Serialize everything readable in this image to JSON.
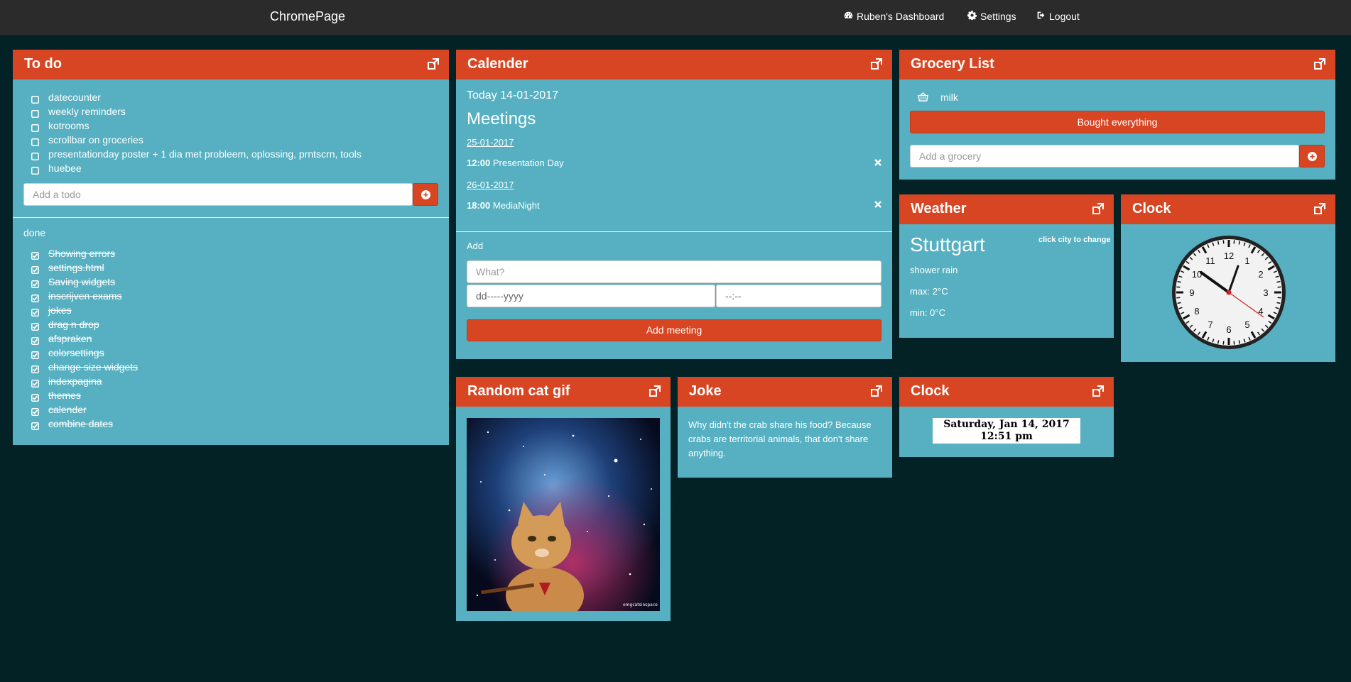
{
  "topbar": {
    "brand": "ChromePage",
    "dashboard": "Ruben's Dashboard",
    "settings": "Settings",
    "logout": "Logout"
  },
  "todo": {
    "title": "To do",
    "items": [
      "datecounter",
      "weekly reminders",
      "kotrooms",
      "scrollbar on groceries",
      "presentationday poster + 1 dia met probleem, oplossing, prntscrn, tools",
      "huebee"
    ],
    "add_placeholder": "Add a todo",
    "done_label": "done",
    "done_items": [
      "Showing errors",
      "settings.html",
      "Saving widgets",
      "inscrijven exams",
      "jokes",
      "drag n drop",
      "afspraken",
      "colorsettings",
      "change size widgets",
      "indexpagina",
      "themes",
      "calender",
      "combine dates"
    ]
  },
  "calendar": {
    "title": "Calender",
    "today": "Today 14-01-2017",
    "meetings_heading": "Meetings",
    "meetings": [
      {
        "date": "25-01-2017",
        "time": "12:00",
        "name": "Presentation Day"
      },
      {
        "date": "26-01-2017",
        "time": "18:00",
        "name": "MediaNight"
      }
    ],
    "add_label": "Add",
    "what_placeholder": "What?",
    "date_placeholder": "dd-----yyyy",
    "time_placeholder": "--:--",
    "add_button": "Add meeting"
  },
  "grocery": {
    "title": "Grocery List",
    "items": [
      "milk"
    ],
    "bought_button": "Bought everything",
    "add_placeholder": "Add a grocery"
  },
  "weather": {
    "title": "Weather",
    "city": "Stuttgart",
    "change_hint": "click city to change",
    "description": "shower rain",
    "max": "max: 2°C",
    "min": "min: 0°C"
  },
  "analog_clock": {
    "title": "Clock",
    "numbers": [
      "12",
      "1",
      "2",
      "3",
      "4",
      "5",
      "6",
      "7",
      "8",
      "9",
      "10",
      "11"
    ]
  },
  "cat": {
    "title": "Random cat gif",
    "watermark": "omgcatsinspace"
  },
  "joke": {
    "title": "Joke",
    "text": "Why didn't the crab share his food? Because crabs are territorial animals, that don't share anything."
  },
  "digital_clock": {
    "title": "Clock",
    "date": "Saturday, Jan 14, 2017",
    "time": "12:51 pm"
  },
  "colors": {
    "background": "#032226",
    "widget": "#56b0c1",
    "header": "#d84523",
    "topbar": "#2b2b2b"
  },
  "icons": [
    "dashboard-icon",
    "gear-icon",
    "logout-icon",
    "resize-icon",
    "checkbox-icon",
    "checked-checkbox-icon",
    "plus-circle-icon",
    "close-icon",
    "basket-icon"
  ]
}
